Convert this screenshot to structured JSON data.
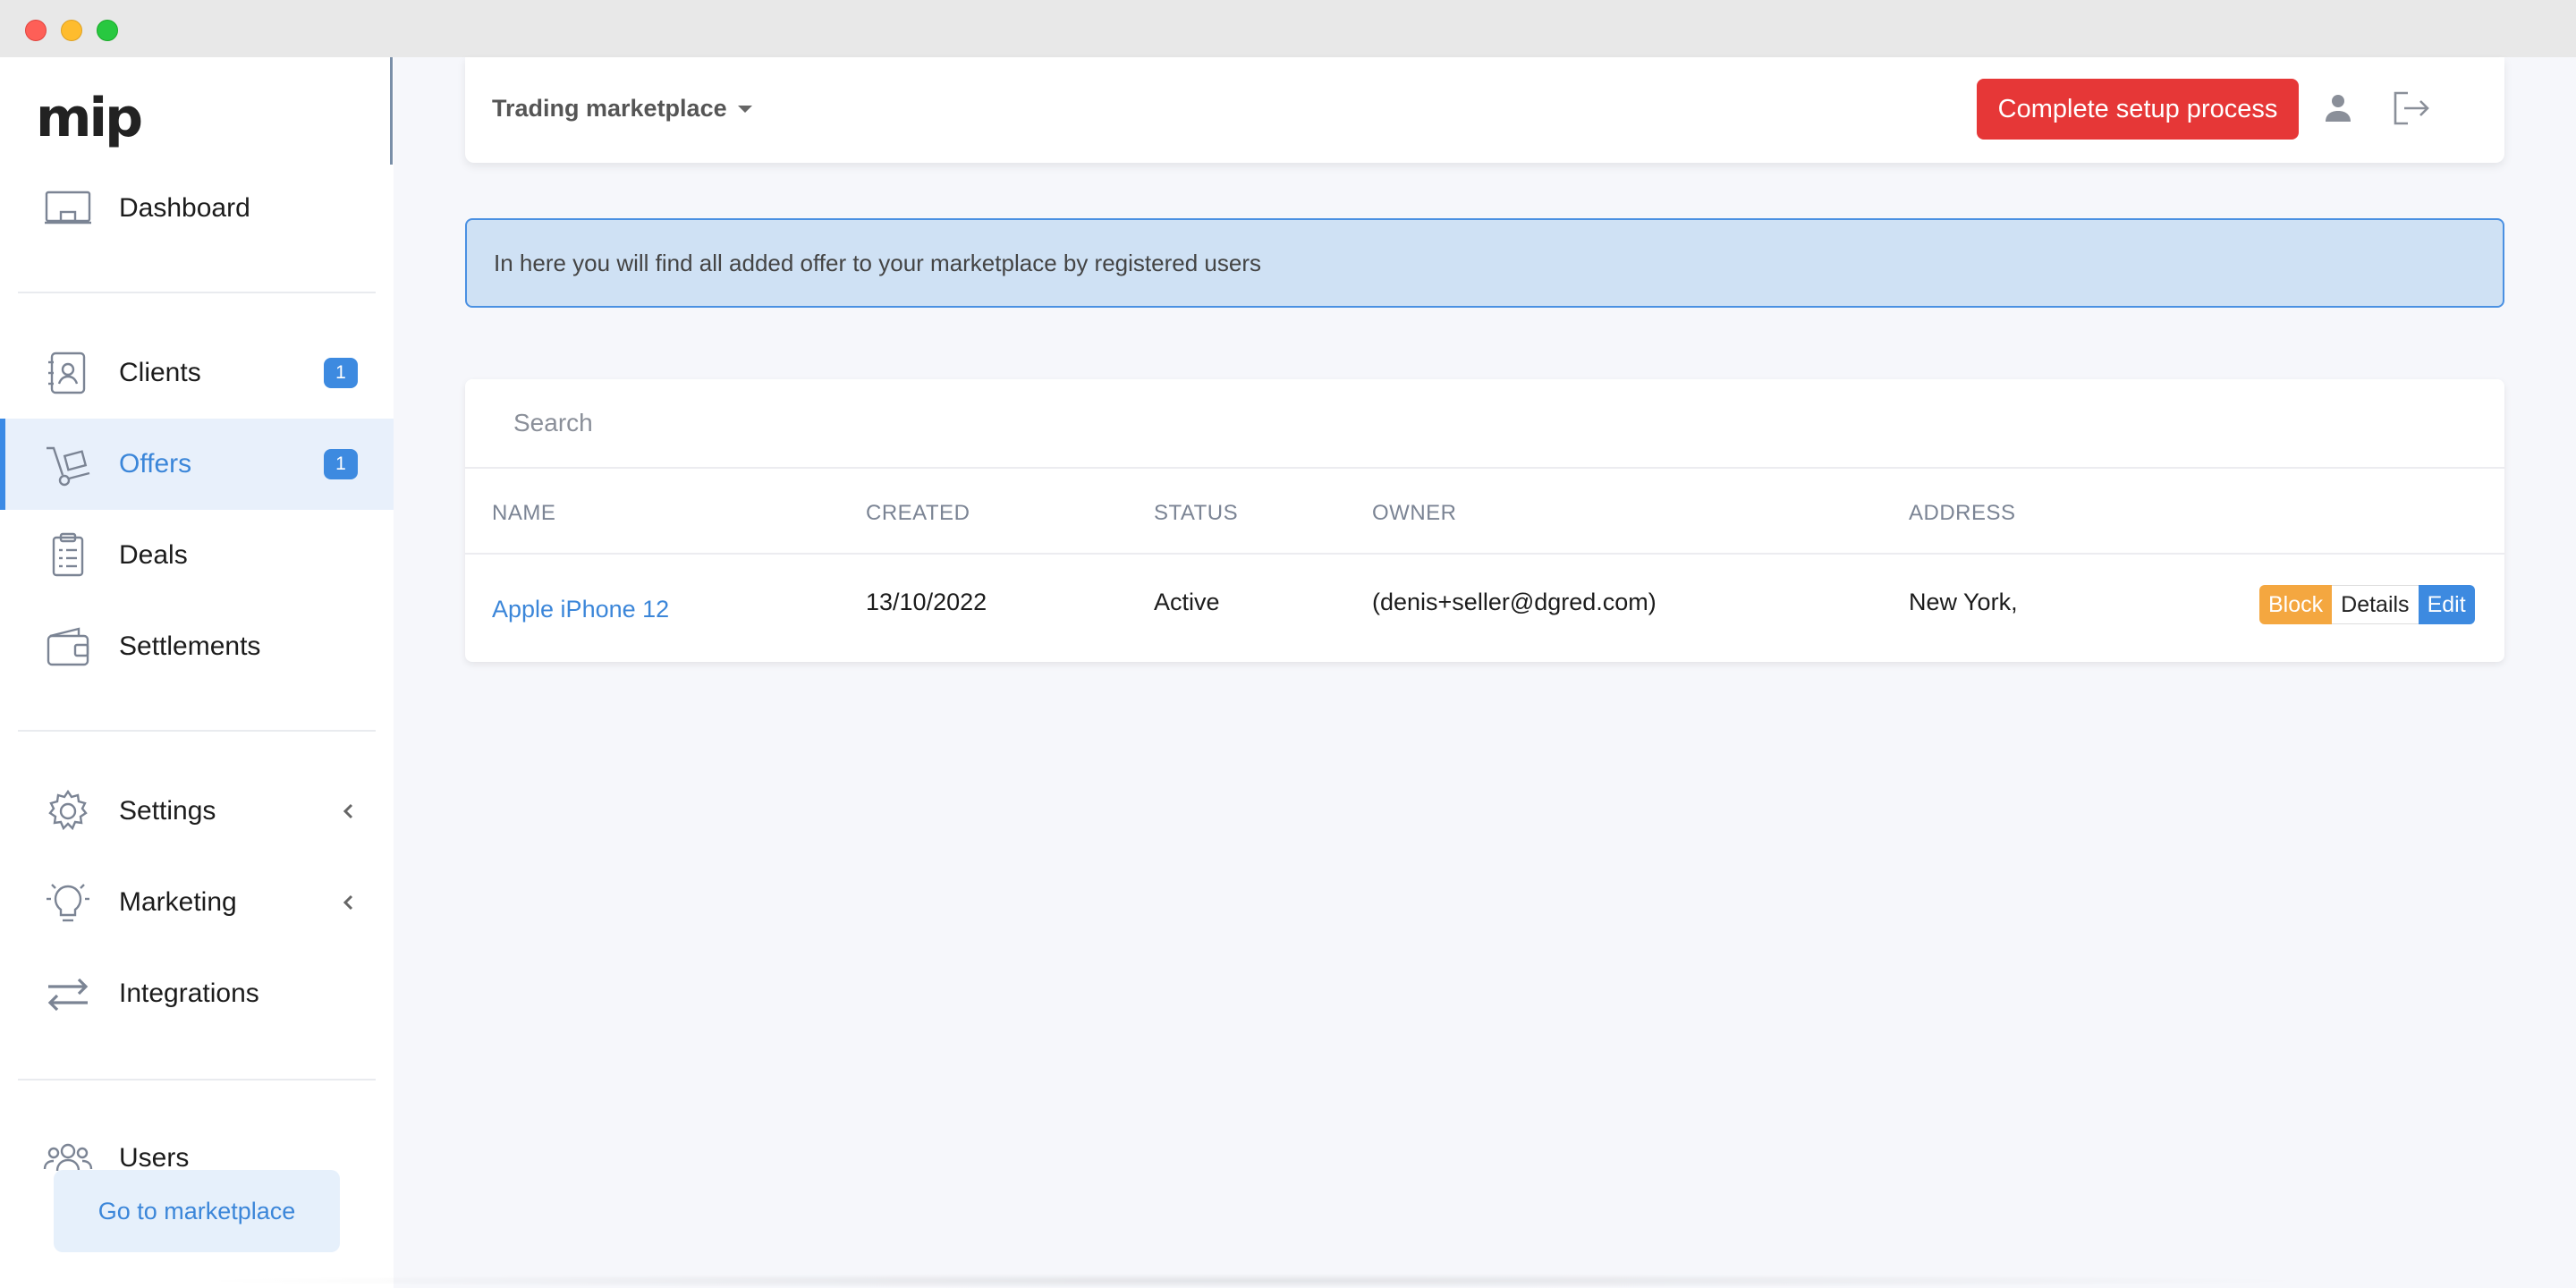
{
  "app": {
    "logo": "mip"
  },
  "sidebar": {
    "items": [
      {
        "label": "Dashboard",
        "icon": "monitor-icon"
      },
      {
        "label": "Clients",
        "icon": "contacts-icon",
        "badge": "1"
      },
      {
        "label": "Offers",
        "icon": "hand-truck-icon",
        "badge": "1",
        "active": true
      },
      {
        "label": "Deals",
        "icon": "clipboard-icon"
      },
      {
        "label": "Settlements",
        "icon": "wallet-icon"
      },
      {
        "label": "Settings",
        "icon": "gear-icon"
      },
      {
        "label": "Marketing",
        "icon": "lightbulb-icon"
      },
      {
        "label": "Integrations",
        "icon": "arrows-exchange-icon"
      },
      {
        "label": "Users",
        "icon": "users-icon"
      }
    ],
    "goto_marketplace": "Go to marketplace"
  },
  "header": {
    "marketplace_select": "Trading marketplace",
    "setup_button": "Complete setup process"
  },
  "info_banner": "In here you will find all added offer to your marketplace by registered users",
  "table": {
    "search_placeholder": "Search",
    "columns": [
      "NAME",
      "CREATED",
      "STATUS",
      "OWNER",
      "ADDRESS"
    ],
    "rows": [
      {
        "name": "Apple iPhone 12",
        "created": "13/10/2022",
        "status": "Active",
        "owner": "(denis+seller@dgred.com)",
        "address": "New York,",
        "actions": {
          "block": "Block",
          "details": "Details",
          "edit": "Edit"
        }
      }
    ]
  },
  "colors": {
    "accent": "#3b86d9",
    "danger": "#e63737",
    "warning": "#f4a740",
    "banner_bg": "#cfe1f4"
  }
}
